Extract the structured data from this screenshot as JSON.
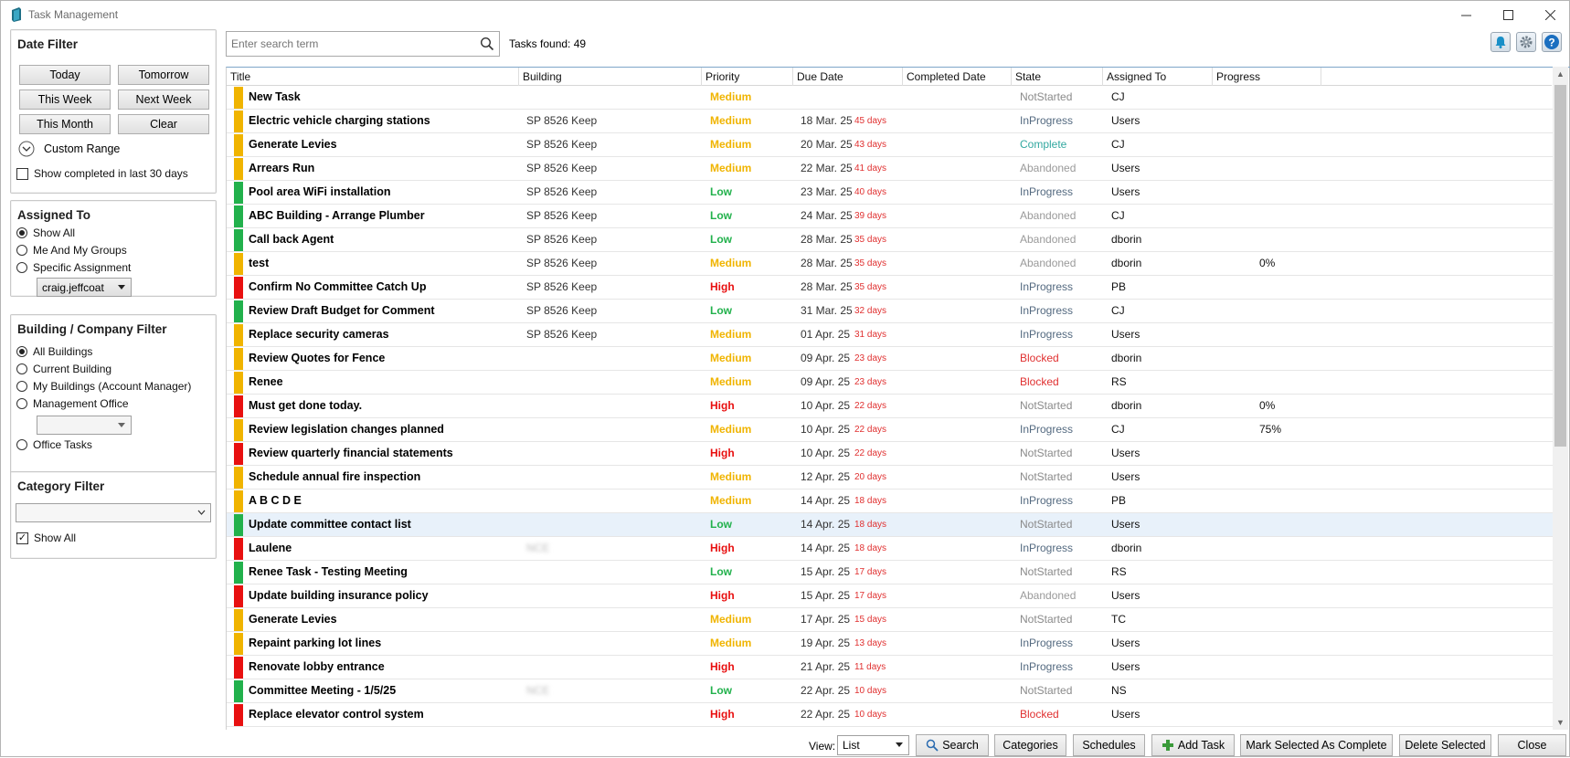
{
  "window": {
    "title": "Task Management"
  },
  "date_filter": {
    "title": "Date Filter",
    "buttons": [
      "Today",
      "Tomorrow",
      "This Week",
      "Next Week",
      "This Month",
      "Clear"
    ],
    "custom_range": "Custom Range",
    "show_completed": "Show completed in last 30 days"
  },
  "assigned_to": {
    "title": "Assigned To",
    "options": [
      "Show All",
      "Me And My Groups",
      "Specific Assignment"
    ],
    "selected": 0,
    "user": "craig.jeffcoat"
  },
  "building_filter": {
    "title": "Building / Company Filter",
    "options": [
      "All Buildings",
      "Current Building",
      "My Buildings (Account Manager)",
      "Management Office",
      "Office Tasks"
    ],
    "selected": 0,
    "office_value": ""
  },
  "category_filter": {
    "title": "Category Filter",
    "value": "",
    "show_all": "Show All"
  },
  "search": {
    "placeholder": "Enter search term",
    "tasks_found": "Tasks found: 49"
  },
  "columns": [
    "Title",
    "Building",
    "Priority",
    "Due Date",
    "Completed Date",
    "State",
    "Assigned To",
    "Progress"
  ],
  "colors": {
    "High": "#e81010",
    "Medium": "#f0b400",
    "Low": "#22b14c",
    "NotStarted": "#8a8a8a",
    "InProgress": "#546a80",
    "Complete": "#32a8a0",
    "Abandoned": "#9a9a9a",
    "Blocked": "#e03030",
    "days": "#e03030"
  },
  "tasks": [
    {
      "title": "New Task",
      "building": "",
      "priority": "Medium",
      "due": "",
      "days": "",
      "state": "NotStarted",
      "assigned": "CJ",
      "progress": ""
    },
    {
      "title": "Electric vehicle charging stations",
      "building": "SP 8526 Keep",
      "priority": "Medium",
      "due": "18 Mar. 25",
      "days": "45 days",
      "state": "InProgress",
      "assigned": "Users",
      "progress": ""
    },
    {
      "title": "Generate Levies",
      "building": "SP 8526 Keep",
      "priority": "Medium",
      "due": "20 Mar. 25",
      "days": "43 days",
      "state": "Complete",
      "assigned": "CJ",
      "progress": ""
    },
    {
      "title": "Arrears Run",
      "building": "SP 8526 Keep",
      "priority": "Medium",
      "due": "22 Mar. 25",
      "days": "41 days",
      "state": "Abandoned",
      "assigned": "Users",
      "progress": ""
    },
    {
      "title": "Pool area WiFi installation",
      "building": "SP 8526 Keep",
      "priority": "Low",
      "due": "23 Mar. 25",
      "days": "40 days",
      "state": "InProgress",
      "assigned": "Users",
      "progress": ""
    },
    {
      "title": "ABC Building - Arrange Plumber",
      "building": "SP 8526 Keep",
      "priority": "Low",
      "due": "24 Mar. 25",
      "days": "39 days",
      "state": "Abandoned",
      "assigned": "CJ",
      "progress": ""
    },
    {
      "title": "Call back Agent",
      "building": "SP 8526 Keep",
      "priority": "Low",
      "due": "28 Mar. 25",
      "days": "35 days",
      "state": "Abandoned",
      "assigned": "dborin",
      "progress": ""
    },
    {
      "title": "test",
      "building": "SP 8526 Keep",
      "priority": "Medium",
      "due": "28 Mar. 25",
      "days": "35 days",
      "state": "Abandoned",
      "assigned": "dborin",
      "progress": "0%"
    },
    {
      "title": "Confirm No Committee Catch Up",
      "building": "SP 8526 Keep",
      "priority": "High",
      "due": "28 Mar. 25",
      "days": "35 days",
      "state": "InProgress",
      "assigned": "PB",
      "progress": ""
    },
    {
      "title": "Review Draft Budget for Comment",
      "building": "SP 8526 Keep",
      "priority": "Low",
      "due": "31 Mar. 25",
      "days": "32 days",
      "state": "InProgress",
      "assigned": "CJ",
      "progress": ""
    },
    {
      "title": "Replace security cameras",
      "building": "SP 8526 Keep",
      "priority": "Medium",
      "due": "01 Apr. 25",
      "days": "31 days",
      "state": "InProgress",
      "assigned": "Users",
      "progress": ""
    },
    {
      "title": "Review Quotes for Fence",
      "building": "",
      "priority": "Medium",
      "due": "09 Apr. 25",
      "days": "23 days",
      "state": "Blocked",
      "assigned": "dborin",
      "progress": ""
    },
    {
      "title": "Renee",
      "building": "",
      "priority": "Medium",
      "due": "09 Apr. 25",
      "days": "23 days",
      "state": "Blocked",
      "assigned": "RS",
      "progress": ""
    },
    {
      "title": "Must get done today.",
      "building": "",
      "priority": "High",
      "due": "10 Apr. 25",
      "days": "22 days",
      "state": "NotStarted",
      "assigned": "dborin",
      "progress": "0%"
    },
    {
      "title": "Review legislation changes planned",
      "building": "",
      "priority": "Medium",
      "due": "10 Apr. 25",
      "days": "22 days",
      "state": "InProgress",
      "assigned": "CJ",
      "progress": "75%"
    },
    {
      "title": "Review quarterly financial statements",
      "building": "",
      "priority": "High",
      "due": "10 Apr. 25",
      "days": "22 days",
      "state": "NotStarted",
      "assigned": "Users",
      "progress": ""
    },
    {
      "title": "Schedule annual fire inspection",
      "building": "",
      "priority": "Medium",
      "due": "12 Apr. 25",
      "days": "20 days",
      "state": "NotStarted",
      "assigned": "Users",
      "progress": ""
    },
    {
      "title": "A B C D E",
      "building": "",
      "priority": "Medium",
      "due": "14 Apr. 25",
      "days": "18 days",
      "state": "InProgress",
      "assigned": "PB",
      "progress": ""
    },
    {
      "title": "Update committee contact list",
      "building": "",
      "priority": "Low",
      "due": "14 Apr. 25",
      "days": "18 days",
      "state": "NotStarted",
      "assigned": "Users",
      "progress": ""
    },
    {
      "title": "Laulene",
      "building": "NCE",
      "priority": "High",
      "due": "14 Apr. 25",
      "days": "18 days",
      "state": "InProgress",
      "assigned": "dborin",
      "progress": ""
    },
    {
      "title": "Renee Task - Testing Meeting",
      "building": "",
      "priority": "Low",
      "due": "15 Apr. 25",
      "days": "17 days",
      "state": "NotStarted",
      "assigned": "RS",
      "progress": ""
    },
    {
      "title": "Update building insurance policy",
      "building": "",
      "priority": "High",
      "due": "15 Apr. 25",
      "days": "17 days",
      "state": "Abandoned",
      "assigned": "Users",
      "progress": ""
    },
    {
      "title": "Generate Levies",
      "building": "",
      "priority": "Medium",
      "due": "17 Apr. 25",
      "days": "15 days",
      "state": "NotStarted",
      "assigned": "TC",
      "progress": ""
    },
    {
      "title": "Repaint parking lot lines",
      "building": "",
      "priority": "Medium",
      "due": "19 Apr. 25",
      "days": "13 days",
      "state": "InProgress",
      "assigned": "Users",
      "progress": ""
    },
    {
      "title": "Renovate lobby entrance",
      "building": "",
      "priority": "High",
      "due": "21 Apr. 25",
      "days": "11 days",
      "state": "InProgress",
      "assigned": "Users",
      "progress": ""
    },
    {
      "title": "Committee Meeting  - 1/5/25",
      "building": "NCE",
      "priority": "Low",
      "due": "22 Apr. 25",
      "days": "10 days",
      "state": "NotStarted",
      "assigned": "NS",
      "progress": ""
    },
    {
      "title": "Replace elevator control system",
      "building": "",
      "priority": "High",
      "due": "22 Apr. 25",
      "days": "10 days",
      "state": "Blocked",
      "assigned": "Users",
      "progress": ""
    }
  ],
  "selected_row": 18,
  "footer": {
    "view_label": "View:",
    "view_value": "List",
    "search": "Search",
    "categories": "Categories",
    "schedules": "Schedules",
    "add_task": "Add Task",
    "mark_complete": "Mark Selected As Complete",
    "delete_selected": "Delete Selected",
    "close": "Close"
  }
}
